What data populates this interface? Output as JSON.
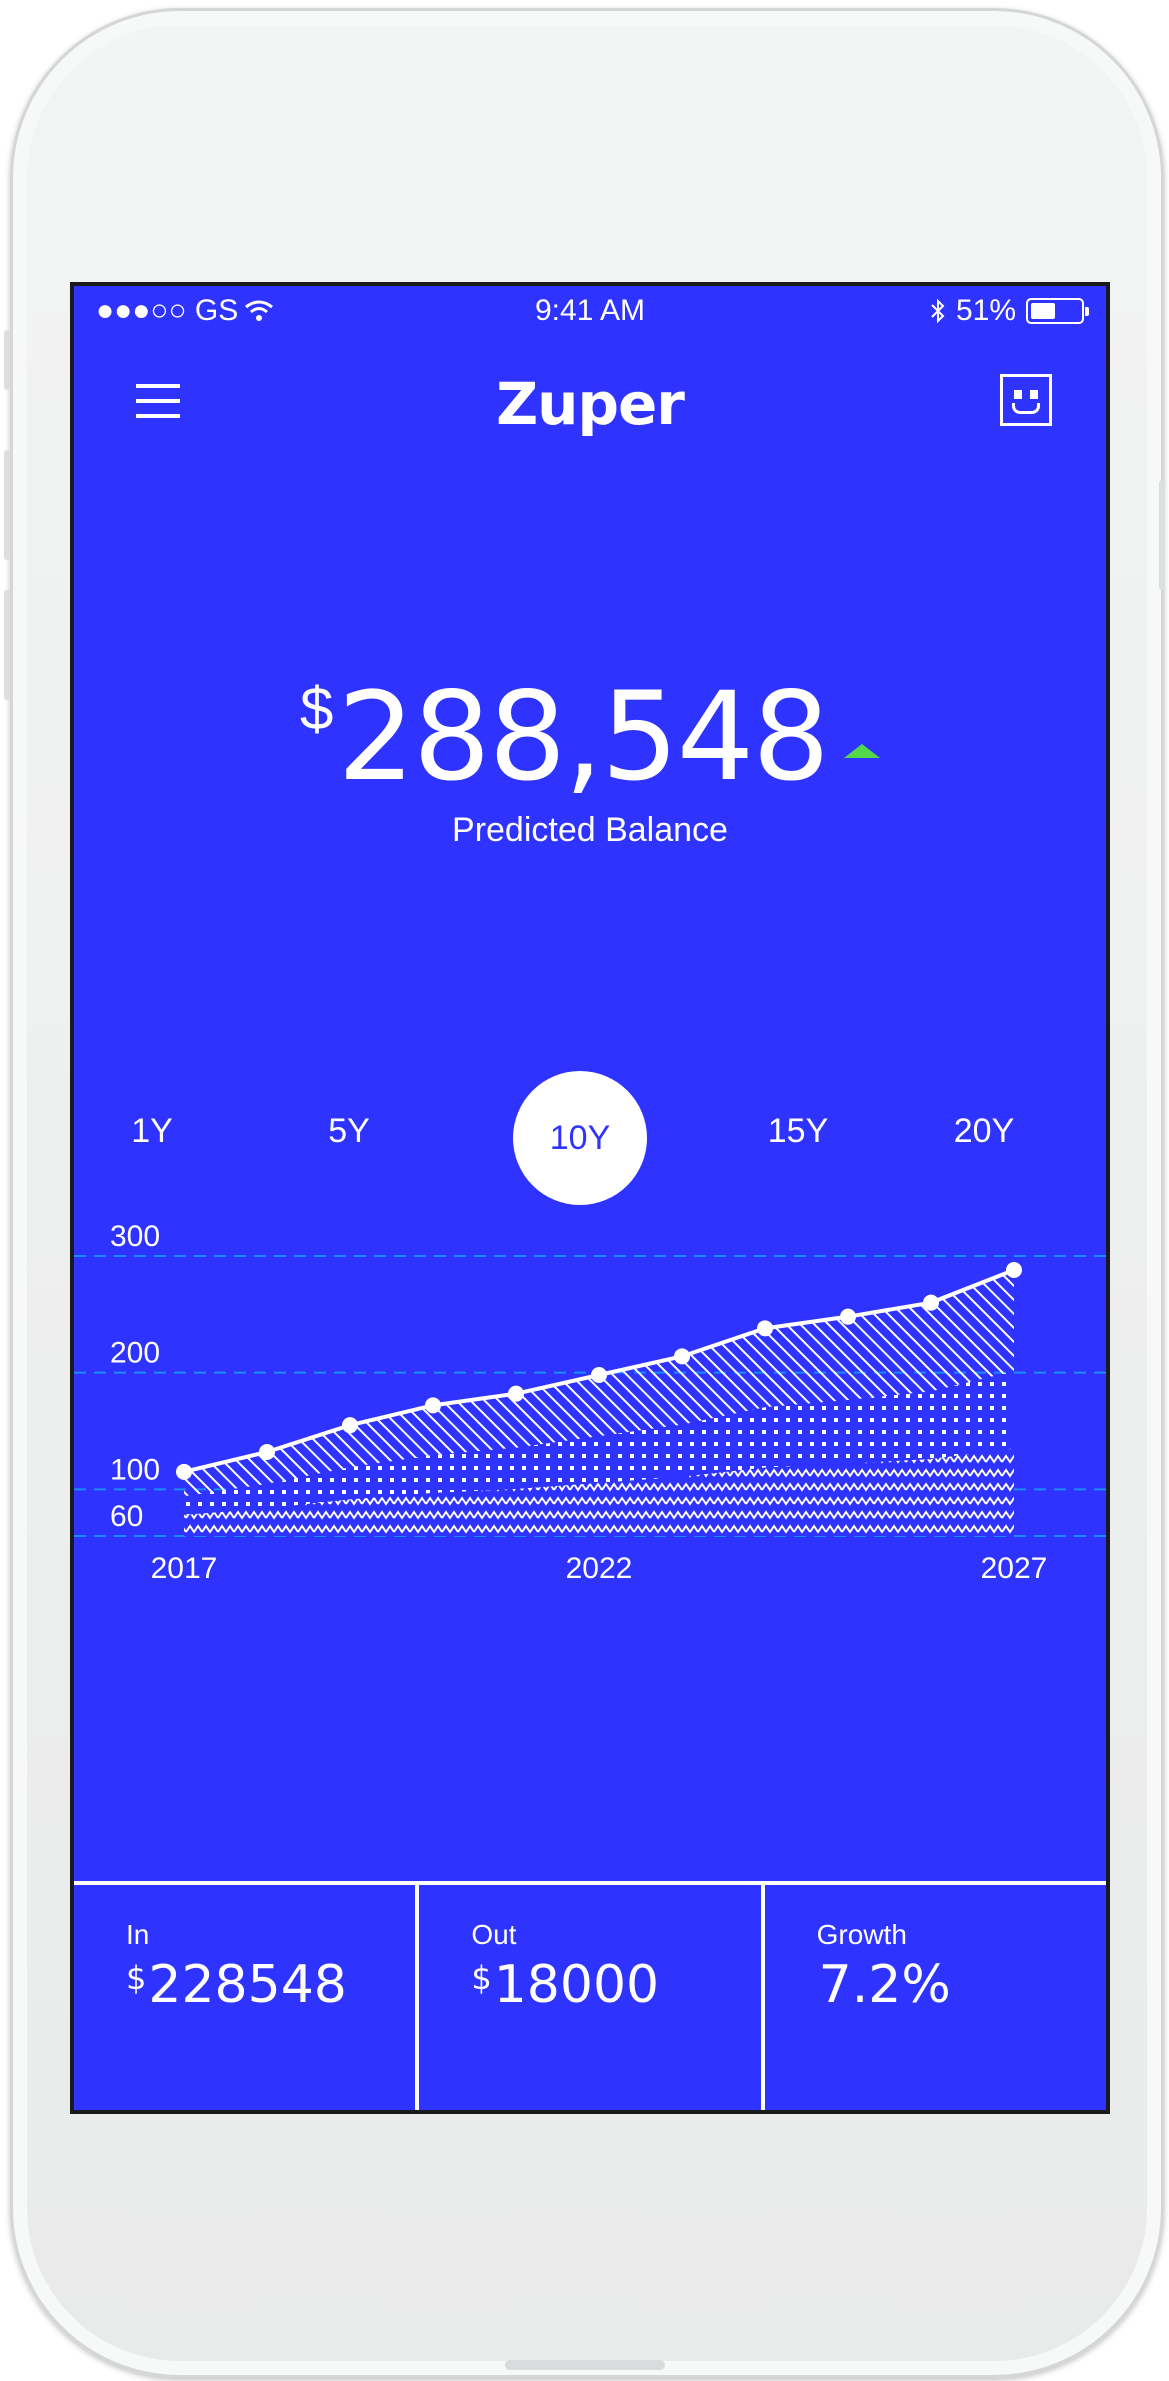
{
  "status_bar": {
    "carrier": "●●●○○ GS",
    "time": "9:41 AM",
    "battery": "51%",
    "battery_level": 0.51
  },
  "header": {
    "title": "Zuper"
  },
  "balance": {
    "currency": "$",
    "amount": "288,548",
    "label": "Predicted Balance",
    "trend": "up"
  },
  "periods": [
    {
      "label": "1Y"
    },
    {
      "label": "5Y"
    },
    {
      "label": "10Y",
      "selected": true
    },
    {
      "label": "15Y"
    },
    {
      "label": "20Y"
    }
  ],
  "chart_data": {
    "type": "area",
    "x": [
      2017,
      2018,
      2019,
      2020,
      2021,
      2022,
      2023,
      2024,
      2025,
      2026,
      2027
    ],
    "series": [
      {
        "values": [
          115,
          132,
          155,
          172,
          182,
          198,
          214,
          238,
          248,
          260,
          288
        ]
      }
    ],
    "ytick_labels": [
      "60",
      "100",
      "200",
      "300"
    ],
    "yticks": [
      60,
      100,
      200,
      300
    ],
    "xtick_labels": [
      "2017",
      "2022",
      "2027"
    ],
    "xticks": [
      2017,
      2022,
      2027
    ],
    "ylim": [
      60,
      300
    ],
    "grid": true,
    "colors": {
      "line": "#ffffff",
      "grid": "#1a8cff",
      "background": "#2f33ff"
    }
  },
  "stats": [
    {
      "label": "In",
      "currency": "$",
      "value": "228548"
    },
    {
      "label": "Out",
      "currency": "$",
      "value": "18000"
    },
    {
      "label": "Growth",
      "currency": "",
      "value": "7.2%"
    }
  ],
  "colors": {
    "accent": "#2f33ff",
    "trend_up": "#54d84a"
  }
}
